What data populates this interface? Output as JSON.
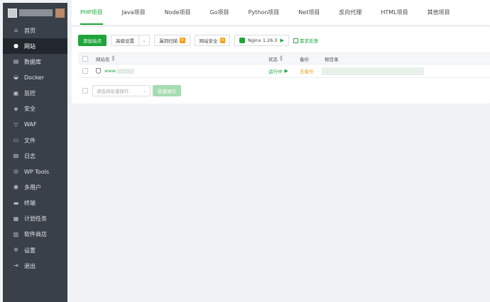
{
  "sidebar": {
    "items": [
      {
        "label": "首页",
        "icon": "home-icon",
        "glyph": "⌂"
      },
      {
        "label": "网站",
        "icon": "globe-icon",
        "glyph": "●",
        "active": true
      },
      {
        "label": "数据库",
        "icon": "database-icon",
        "glyph": "▤"
      },
      {
        "label": "Docker",
        "icon": "docker-icon",
        "glyph": "◒"
      },
      {
        "label": "监控",
        "icon": "monitor-icon",
        "glyph": "▣"
      },
      {
        "label": "安全",
        "icon": "shield-icon",
        "glyph": "◈"
      },
      {
        "label": "WAF",
        "icon": "waf-icon",
        "glyph": "▽"
      },
      {
        "label": "文件",
        "icon": "folder-icon",
        "glyph": "▭"
      },
      {
        "label": "日志",
        "icon": "log-icon",
        "glyph": "▤"
      },
      {
        "label": "WP Tools",
        "icon": "wordpress-icon",
        "glyph": "◎"
      },
      {
        "label": "多用户",
        "icon": "users-icon",
        "glyph": "◉"
      },
      {
        "label": "终端",
        "icon": "terminal-icon",
        "glyph": "▬"
      },
      {
        "label": "计划任务",
        "icon": "calendar-icon",
        "glyph": "▦"
      },
      {
        "label": "软件商店",
        "icon": "store-icon",
        "glyph": "▥"
      },
      {
        "label": "设置",
        "icon": "gear-icon",
        "glyph": "✲"
      },
      {
        "label": "退出",
        "icon": "logout-icon",
        "glyph": "⇥"
      }
    ]
  },
  "tabs": [
    {
      "label": "PHP项目",
      "active": true
    },
    {
      "label": "Java项目"
    },
    {
      "label": "Node项目"
    },
    {
      "label": "Go项目"
    },
    {
      "label": "Python项目"
    },
    {
      "label": "Net项目"
    },
    {
      "label": "反向代理"
    },
    {
      "label": "HTML项目"
    },
    {
      "label": "其他项目"
    }
  ],
  "toolbar": {
    "add_site": "添加站点",
    "advanced_settings": "高级设置",
    "vuln_scan": "漏洞扫描",
    "vuln_scan_badge": "0",
    "site_security": "网站安全",
    "site_security_badge": "0",
    "nginx": "Nginx 1.26.3",
    "feedback": "需求反馈"
  },
  "table": {
    "headers": {
      "site_name": "网站名",
      "status": "状态",
      "backup": "备份",
      "root_dir": "根目录"
    },
    "rows": [
      {
        "site": "www.",
        "site_suffix": "",
        "status": "运行中",
        "backup": "无备份"
      }
    ]
  },
  "batch": {
    "placeholder": "请选择批量操作",
    "button": "批量操作"
  },
  "colors": {
    "accent": "#20a53a",
    "sidebar_bg": "#394049",
    "warning": "#f0a020"
  }
}
